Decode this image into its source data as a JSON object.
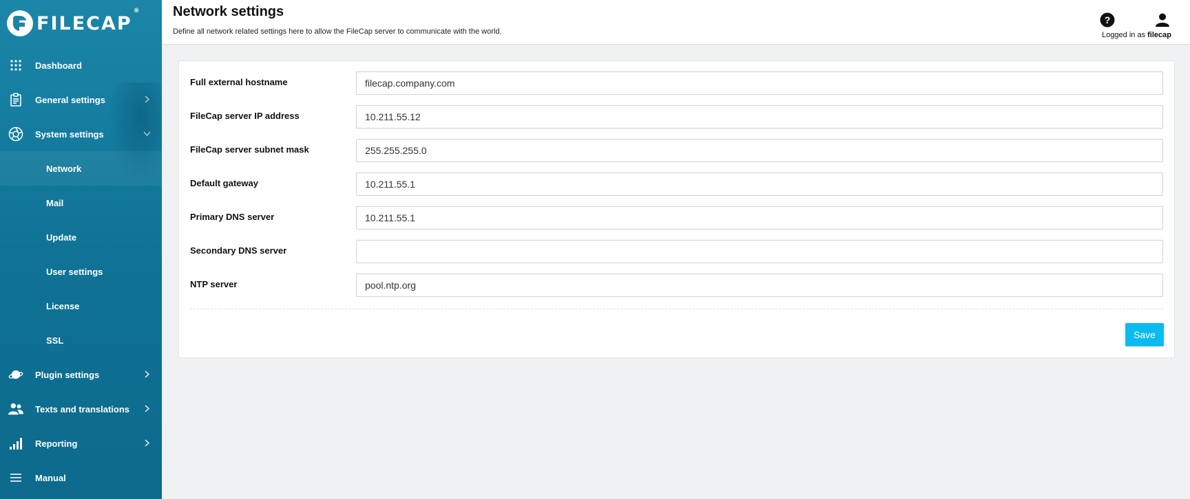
{
  "app": {
    "logo_text": "FILECAP",
    "logo_reg": "®"
  },
  "colors": {
    "sidebar": "#1480a3",
    "accent": "#0bbbf0",
    "background": "#f0f1f3"
  },
  "sidebar": {
    "items": [
      {
        "label": "Dashboard",
        "icon": "grid-icon",
        "chevron": "none"
      },
      {
        "label": "General settings",
        "icon": "clipboard-icon",
        "chevron": "right"
      },
      {
        "label": "System settings",
        "icon": "aperture-icon",
        "chevron": "down"
      },
      {
        "label": "Plugin settings",
        "icon": "planet-icon",
        "chevron": "right"
      },
      {
        "label": "Texts and translations",
        "icon": "users-icon",
        "chevron": "right"
      },
      {
        "label": "Reporting",
        "icon": "signal-bars-icon",
        "chevron": "right"
      },
      {
        "label": "Manual",
        "icon": "menu-lines-icon",
        "chevron": "none"
      }
    ],
    "system_sub": [
      {
        "label": "Network",
        "active": true
      },
      {
        "label": "Mail"
      },
      {
        "label": "Update"
      },
      {
        "label": "User settings"
      },
      {
        "label": "License"
      },
      {
        "label": "SSL"
      }
    ]
  },
  "header": {
    "title": "Network settings",
    "description": "Define all network related settings here to allow the FileCap server to communicate with the world.",
    "logged_in_prefix": "Logged in as",
    "username": "filecap",
    "help_icon": "help-circle-icon",
    "user_icon": "user-icon"
  },
  "form": {
    "fields": [
      {
        "label": "Full external hostname",
        "value": "filecap.company.com"
      },
      {
        "label": "FileCap server IP address",
        "value": "10.211.55.12"
      },
      {
        "label": "FileCap server subnet mask",
        "value": "255.255.255.0"
      },
      {
        "label": "Default gateway",
        "value": "10.211.55.1"
      },
      {
        "label": "Primary DNS server",
        "value": "10.211.55.1"
      },
      {
        "label": "Secondary DNS server",
        "value": ""
      },
      {
        "label": "NTP server",
        "value": "pool.ntp.org"
      }
    ],
    "save_label": "Save"
  }
}
